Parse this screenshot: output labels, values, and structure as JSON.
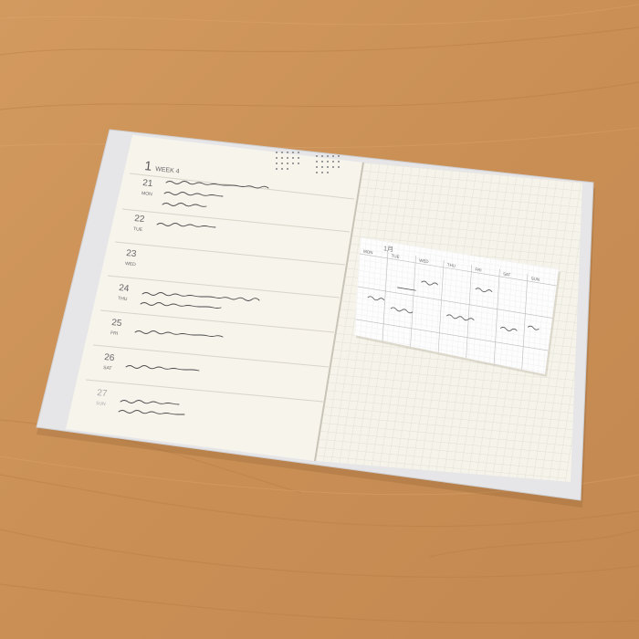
{
  "scene": {
    "colors": {
      "wood": "#c98f55",
      "cover": "#e6e6e8",
      "page": "#f6f3ea",
      "grid": "#dcdccf",
      "ink": "#4a4a4a"
    }
  },
  "left_page": {
    "month_number": "1",
    "week_label": "WEEK 4",
    "days": [
      {
        "date": "21",
        "day": "MON"
      },
      {
        "date": "22",
        "day": "TUE"
      },
      {
        "date": "23",
        "day": "WED"
      },
      {
        "date": "24",
        "day": "THU"
      },
      {
        "date": "25",
        "day": "FRI"
      },
      {
        "date": "26",
        "day": "SAT"
      },
      {
        "date": "27",
        "day": "SUN"
      }
    ]
  },
  "sticky_note": {
    "month": "1月",
    "weekdays": [
      "MON",
      "TUE",
      "WED",
      "THU",
      "FRI",
      "SAT",
      "SUN"
    ]
  }
}
